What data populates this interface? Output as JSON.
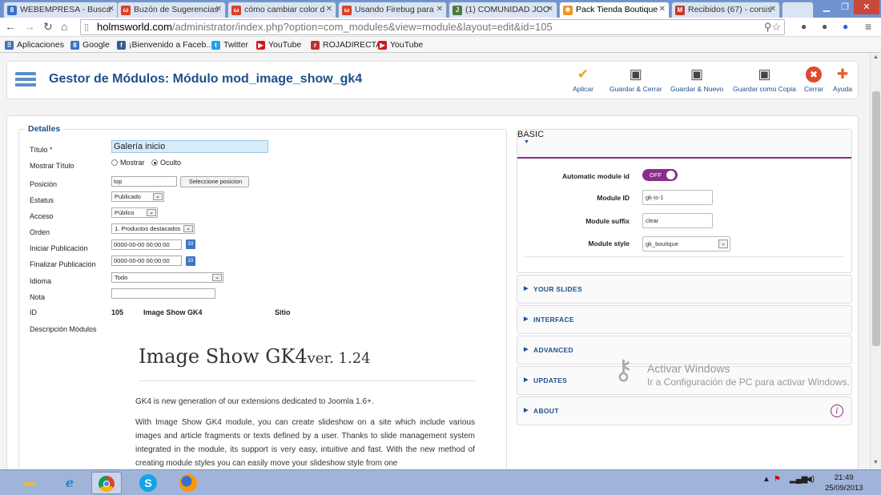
{
  "browser": {
    "tabs": [
      {
        "label": "WEBEMPRESA - Busca",
        "icon": "google-sites-icon",
        "color": "#3b6fc7",
        "glyph": "8"
      },
      {
        "label": "Buzón de Sugerencias",
        "icon": "uservoice-icon",
        "color": "#d9412b",
        "glyph": "ω"
      },
      {
        "label": "cómo cambiar color d",
        "icon": "uservoice-icon",
        "color": "#d9412b",
        "glyph": "ω"
      },
      {
        "label": "Usando Firebug para",
        "icon": "uservoice-icon",
        "color": "#d9412b",
        "glyph": "ω"
      },
      {
        "label": "(1) COMUNIDAD JOO",
        "icon": "joomla-community-icon",
        "color": "#4a7a3c",
        "glyph": "J"
      },
      {
        "label": "Pack Tienda Boutique",
        "icon": "joomla-icon",
        "color": "#f29425",
        "glyph": "✱"
      },
      {
        "label": "Recibidos (67) - corsis",
        "icon": "gmail-icon",
        "color": "#c33a2c",
        "glyph": "M"
      }
    ],
    "url_host": "holmsworld.com",
    "url_path": "/administrator/index.php?option=com_modules&view=module&layout=edit&id=105",
    "bookmarks": [
      {
        "label": "Aplicaciones",
        "color": "#3b6fc7",
        "glyph": "⠿"
      },
      {
        "label": "Google",
        "color": "#3b6fc7",
        "glyph": "8"
      },
      {
        "label": "¡Bienvenido a Faceb...",
        "color": "#3b5998",
        "glyph": "f"
      },
      {
        "label": "Twitter",
        "color": "#1da1f2",
        "glyph": "🐦"
      },
      {
        "label": "YouTube",
        "color": "#cc181e",
        "glyph": "▶"
      },
      {
        "label": "ROJADIRECTA",
        "color": "#b33",
        "glyph": "⚽"
      },
      {
        "label": "YouTube",
        "color": "#cc181e",
        "glyph": "▶"
      }
    ]
  },
  "header": {
    "title": "Gestor de Módulos: Módulo mod_image_show_gk4",
    "buttons": [
      {
        "label": "Aplicar",
        "icon": "check-icon",
        "glyph": "✔",
        "color": "#f0a020"
      },
      {
        "label": "Guardar & Cerrar",
        "icon": "save-icon",
        "glyph": "💾",
        "color": "#444"
      },
      {
        "label": "Guardar & Nuevo",
        "icon": "save-new-icon",
        "glyph": "💾",
        "color": "#444"
      },
      {
        "label": "Guardar como Copia",
        "icon": "save-copy-icon",
        "glyph": "💾",
        "color": "#444"
      },
      {
        "label": "Cerrar",
        "icon": "close-circle-icon",
        "glyph": "✖",
        "color": "#e04a2a"
      },
      {
        "label": "Ayuda",
        "icon": "help-lifebuoy-icon",
        "glyph": "✚",
        "color": "#e8602c"
      }
    ]
  },
  "details": {
    "legend": "Detalles",
    "titulo_label": "Título",
    "titulo_required": "*",
    "titulo_value": "Galería inicio",
    "mostrar_titulo_label": "Mostrar Título",
    "radio_show": "Mostrar",
    "radio_hide": "Oculto",
    "posicion_label": "Posición",
    "posicion_value": "top",
    "posicion_button": "Seleccione posicion",
    "estatus_label": "Estatus",
    "estatus_value": "Publicado",
    "acceso_label": "Acceso",
    "acceso_value": "Público",
    "orden_label": "Orden",
    "orden_value": "1. Productos destacados",
    "iniciar_label": "Iniciar Publicación",
    "iniciar_value": "0000-00-00 00:00:00",
    "finalizar_label": "Finalizar Publicación",
    "finalizar_value": "0000-00-00 00:00:00",
    "calendar_glyph": "33",
    "idioma_label": "Idioma",
    "idioma_value": "Todo",
    "nota_label": "Nota",
    "nota_value": "",
    "id_label": "ID",
    "id_value": "105",
    "module_type": "Image Show GK4",
    "site": "Sitio",
    "descripcion_label": "Descripción Módulos"
  },
  "description": {
    "title": "Image Show GK4",
    "version": "ver. 1.24",
    "p1": "GK4 is new generation of our extensions dedicated to Joomla 1.6+.",
    "p2": "With Image Show GK4 module, you can create slideshow on a site which include various images and article fragments or texts defined by a user. Thanks to slide management system integrated in the module, its support is very easy, intuitive and fast. With the new method of creating module styles you can easily move your slideshow style from one"
  },
  "options": {
    "basic_label": "BASIC",
    "automatic_id_label": "Automatic module id",
    "automatic_id_value": "OFF",
    "module_id_label": "Module ID",
    "module_id_value": "gk-is-1",
    "module_suffix_label": "Module suffix",
    "module_suffix_value": "clear",
    "module_style_label": "Module style",
    "module_style_value": "gk_boutique",
    "sections": [
      "YOUR SLIDES",
      "INTERFACE",
      "ADVANCED",
      "UPDATES",
      "ABOUT"
    ],
    "accent": "#8b2c8b"
  },
  "watermark": {
    "line1": "Activar Windows",
    "line2": "Ir a Configuración de PC para activar Windows."
  },
  "taskbar": {
    "time": "21:49",
    "date": "25/09/2013"
  }
}
